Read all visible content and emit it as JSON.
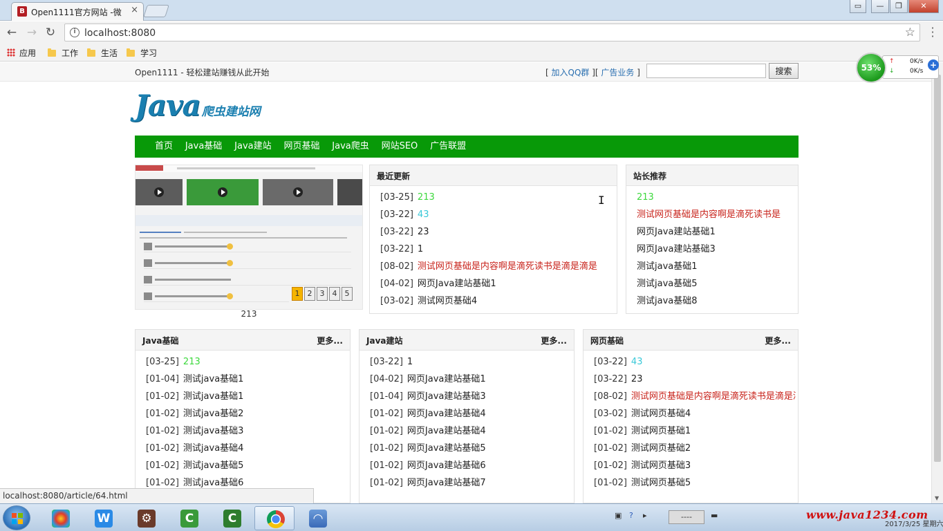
{
  "browser": {
    "tab_title": "Open1111官方网站 -微",
    "tab_close": "×",
    "url": "localhost:8080",
    "back_glyph": "←",
    "forward_glyph": "→",
    "reload_glyph": "↻",
    "star_glyph": "☆",
    "window_buttons": [
      "▭",
      "—",
      "❐",
      "✕"
    ],
    "bookmarks": [
      "应用",
      "工作",
      "生活",
      "学习"
    ]
  },
  "site": {
    "slogan": "Open1111 - 轻松建站赚钱从此开始",
    "toplinks": {
      "open": "[ ",
      "qq": "加入QQ群",
      "mid": " ][ ",
      "ad": "广告业务",
      "close": " ]"
    },
    "search_button": "搜索",
    "search_value": "",
    "logo_main": "Java",
    "logo_sub": "爬虫建站网",
    "nav": [
      "首页",
      "Java基础",
      "Java建站",
      "网页基础",
      "Java爬虫",
      "网站SEO",
      "广告联盟"
    ]
  },
  "slideshow": {
    "pages": [
      "1",
      "2",
      "3",
      "4",
      "5"
    ],
    "active_page": "1",
    "caption": "213"
  },
  "latest": {
    "title": "最近更新",
    "items": [
      {
        "date": "[03-25]",
        "title": "213",
        "color": "#3cd83c"
      },
      {
        "date": "[03-22]",
        "title": "43",
        "color": "#38c8d8"
      },
      {
        "date": "[03-22]",
        "title": "23",
        "color": "#222222"
      },
      {
        "date": "[03-22]",
        "title": "1",
        "color": "#222222"
      },
      {
        "date": "[08-02]",
        "title": "测试网页基础是内容啊是滴死读书是滴是滴是",
        "color": "#c8231b"
      },
      {
        "date": "[04-02]",
        "title": "网页Java建站基础1",
        "color": "#222222"
      },
      {
        "date": "[03-02]",
        "title": "测试网页基础4",
        "color": "#222222"
      }
    ]
  },
  "recommend": {
    "title": "站长推荐",
    "items": [
      {
        "title": "213",
        "color": "#3cd83c"
      },
      {
        "title": "测试网页基础是内容啊是滴死读书是",
        "color": "#c8231b"
      },
      {
        "title": "网页Java建站基础1",
        "color": "#222222"
      },
      {
        "title": "网页Java建站基础3",
        "color": "#222222"
      },
      {
        "title": "测试java基础1",
        "color": "#222222"
      },
      {
        "title": "测试java基础5",
        "color": "#222222"
      },
      {
        "title": "测试java基础8",
        "color": "#222222"
      }
    ]
  },
  "columns": [
    {
      "title": "Java基础",
      "more": "更多...",
      "items": [
        {
          "date": "[03-25]",
          "title": "213",
          "color": "#3cd83c"
        },
        {
          "date": "[01-04]",
          "title": "测试java基础1",
          "color": "#222222"
        },
        {
          "date": "[01-02]",
          "title": "测试java基础1",
          "color": "#222222"
        },
        {
          "date": "[01-02]",
          "title": "测试java基础2",
          "color": "#222222"
        },
        {
          "date": "[01-02]",
          "title": "测试java基础3",
          "color": "#222222"
        },
        {
          "date": "[01-02]",
          "title": "测试java基础4",
          "color": "#222222"
        },
        {
          "date": "[01-02]",
          "title": "测试java基础5",
          "color": "#222222"
        },
        {
          "date": "[01-02]",
          "title": "测试java基础6",
          "color": "#222222"
        }
      ]
    },
    {
      "title": "Java建站",
      "more": "更多...",
      "items": [
        {
          "date": "[03-22]",
          "title": "1",
          "color": "#222222"
        },
        {
          "date": "[04-02]",
          "title": "网页Java建站基础1",
          "color": "#222222"
        },
        {
          "date": "[01-04]",
          "title": "网页Java建站基础3",
          "color": "#222222"
        },
        {
          "date": "[01-02]",
          "title": "网页Java建站基础4",
          "color": "#222222"
        },
        {
          "date": "[01-02]",
          "title": "网页Java建站基础4",
          "color": "#222222"
        },
        {
          "date": "[01-02]",
          "title": "网页Java建站基础5",
          "color": "#222222"
        },
        {
          "date": "[01-02]",
          "title": "网页Java建站基础6",
          "color": "#222222"
        },
        {
          "date": "[01-02]",
          "title": "网页Java建站基础7",
          "color": "#222222"
        }
      ]
    },
    {
      "title": "网页基础",
      "more": "更多...",
      "items": [
        {
          "date": "[03-22]",
          "title": "43",
          "color": "#38c8d8"
        },
        {
          "date": "[03-22]",
          "title": "23",
          "color": "#222222"
        },
        {
          "date": "[08-02]",
          "title": "测试网页基础是内容啊是滴死读书是滴是滴",
          "color": "#c8231b"
        },
        {
          "date": "[03-02]",
          "title": "测试网页基础4",
          "color": "#222222"
        },
        {
          "date": "[01-02]",
          "title": "测试网页基础1",
          "color": "#222222"
        },
        {
          "date": "[01-02]",
          "title": "测试网页基础2",
          "color": "#222222"
        },
        {
          "date": "[01-02]",
          "title": "测试网页基础3",
          "color": "#222222"
        },
        {
          "date": "[01-02]",
          "title": "测试网页基础5",
          "color": "#222222"
        }
      ]
    }
  ],
  "status_url": "localhost:8080/article/64.html",
  "net_widget": {
    "percent": "53%",
    "up_arrow": "↑",
    "down_arrow": "↓",
    "up": "0K/s",
    "down": "0K/s",
    "plus": "+"
  },
  "taskbar": {
    "watermark": "www.java1234.com",
    "clock": "2017/3/25 星期六",
    "tray_box": "----"
  }
}
